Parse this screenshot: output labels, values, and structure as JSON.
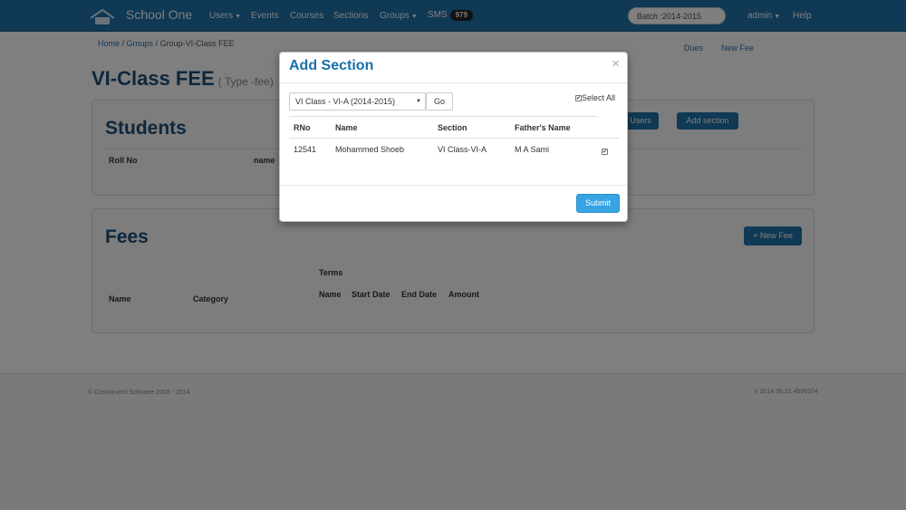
{
  "nav": {
    "brand": "School One",
    "items": [
      {
        "label": "Users",
        "dropdown": true
      },
      {
        "label": "Events",
        "dropdown": false
      },
      {
        "label": "Courses",
        "dropdown": false
      },
      {
        "label": "Sections",
        "dropdown": false
      },
      {
        "label": "Groups",
        "dropdown": true
      },
      {
        "label": "SMS",
        "dropdown": false
      }
    ],
    "sms_count": "979",
    "batch_value": "Batch :2014-2015",
    "admin_label": "admin",
    "help_label": "Help"
  },
  "breadcrumb": {
    "home": "Home",
    "groups": "Groups",
    "current": "Group-VI-Class FEE"
  },
  "top_links": {
    "dues": "Dues",
    "new_fee": "New Fee"
  },
  "page": {
    "title": "VI-Class FEE",
    "type_label": "( Type -fee)"
  },
  "students_panel": {
    "title": "Students",
    "users_btn": "Users",
    "add_section_btn": "Add section",
    "cols": [
      "Roll No",
      "name"
    ]
  },
  "fees_panel": {
    "title": "Fees",
    "new_fee_btn": "New Fee",
    "col_name": "Name",
    "col_category": "Category",
    "terms_header": "Terms",
    "term_cols": [
      "Name",
      "Start Date",
      "End Date",
      "Amount"
    ]
  },
  "footer": {
    "left": "© Cosmicvent Software 2009 - 2014",
    "right": "V 2014.06.21.4b96104"
  },
  "modal": {
    "title": "Add Section",
    "close_glyph": "×",
    "select_value": "VI Class - VI-A (2014-2015)",
    "go_label": "Go",
    "select_all_label": "Select All",
    "select_all_checked": true,
    "columns": [
      "RNo",
      "Name",
      "Section",
      "Father's Name"
    ],
    "rows": [
      {
        "rno": "12541",
        "name": "Mohammed Shoeb",
        "section": "VI Class-VI-A",
        "father": "M A Sami",
        "checked": true
      }
    ],
    "submit_label": "Submit"
  },
  "colors": {
    "nav_bg": "#1e73a8",
    "accent": "#1a6fa8",
    "submit": "#37a3e3",
    "overlay": "rgba(0,0,0,0.5)"
  }
}
